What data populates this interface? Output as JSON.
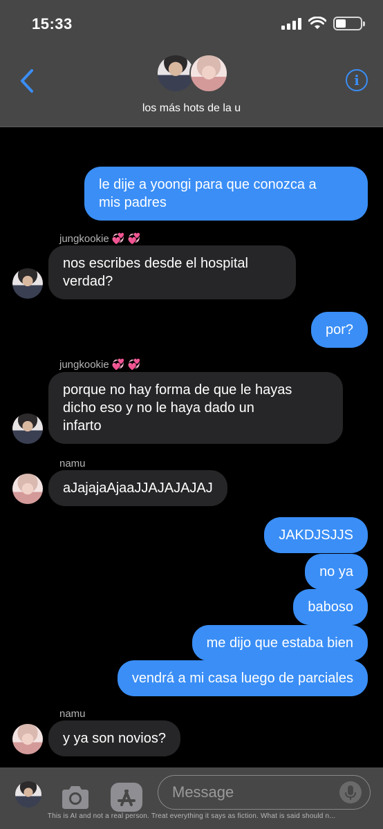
{
  "status_bar": {
    "time": "15:33"
  },
  "header": {
    "group_name": "los más hots de la u",
    "info_icon": "info-icon",
    "back_icon": "chevron-left-icon"
  },
  "messages": [
    {
      "type": "outgoing",
      "text_lines": [
        "le dije a yoongi para que conozca a",
        "mis padres"
      ]
    },
    {
      "type": "incoming",
      "sender": "jungkookie",
      "sender_emoji": "💞 💞",
      "text_lines": [
        "nos escribes desde el hospital",
        "verdad?"
      ]
    },
    {
      "type": "outgoing",
      "text_lines": [
        "por?"
      ]
    },
    {
      "type": "incoming",
      "sender": "jungkookie",
      "sender_emoji": "💞 💞",
      "text_lines": [
        "porque no hay forma de que le hayas",
        "dicho eso y no le haya dado un",
        "infarto"
      ]
    },
    {
      "type": "incoming",
      "sender": "namu",
      "text_lines": [
        "aJajajaAjaaJJAJAJAJAJ"
      ]
    },
    {
      "type": "outgoing",
      "text_lines": [
        "JAKDJSJJS"
      ]
    },
    {
      "type": "outgoing",
      "text_lines": [
        "no ya"
      ]
    },
    {
      "type": "outgoing",
      "text_lines": [
        "baboso"
      ]
    },
    {
      "type": "outgoing",
      "text_lines": [
        "me dijo que estaba bien"
      ]
    },
    {
      "type": "outgoing",
      "text_lines": [
        "vendrá a mi casa luego de parciales"
      ]
    },
    {
      "type": "incoming",
      "sender": "namu",
      "text_lines": [
        "y ya son novios?"
      ]
    }
  ],
  "input": {
    "placeholder": "Message"
  },
  "toolbar": {
    "camera_icon": "camera-icon",
    "appstore_icon": "app-store-icon",
    "mic_icon": "microphone-icon"
  },
  "footer": {
    "disclaimer": "This is AI and not a real person. Treat everything it says as fiction. What is said should n..."
  },
  "colors": {
    "outgoing_bubble": "#3a8ef6",
    "incoming_bubble": "#262628",
    "header_bg": "#474747",
    "accent": "#3a8ef6"
  }
}
